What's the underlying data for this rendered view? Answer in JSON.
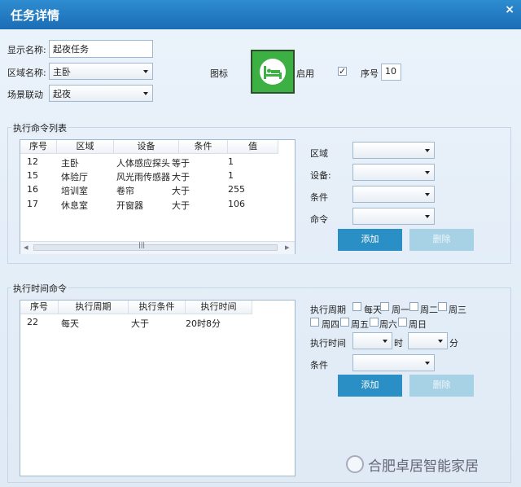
{
  "window": {
    "title": "任务详情",
    "close_glyph": "×"
  },
  "form": {
    "display_name_label": "显示名称:",
    "display_name_value": "起夜任务",
    "area_label": "区域名称:",
    "area_value": "主卧",
    "scene_label": "场景联动",
    "scene_value": "起夜",
    "icon_label": "图标",
    "enable_label": "启用",
    "enable_checked": "✓",
    "seq_label": "序号",
    "seq_value": "10"
  },
  "command_section": {
    "title": "执行命令列表",
    "columns": [
      "序号",
      "区域",
      "设备",
      "条件",
      "值"
    ],
    "rows": [
      [
        "12",
        "主卧",
        "人体感应探头",
        "等于",
        "1"
      ],
      [
        "15",
        "体验厅",
        "风光雨传感器",
        "大于",
        "1"
      ],
      [
        "16",
        "培训室",
        "卷帘",
        "大于",
        "255"
      ],
      [
        "17",
        "休息室",
        "开窗器",
        "大于",
        "106"
      ]
    ],
    "scroll_left": "◂",
    "scroll_right": "▸",
    "scroll_grip": "|||",
    "fields": {
      "area": "区域",
      "device": "设备:",
      "condition": "条件",
      "command": "命令"
    },
    "add_label": "添加",
    "delete_label": "删除"
  },
  "time_section": {
    "title": "执行时间命令",
    "columns": [
      "序号",
      "执行周期",
      "执行条件",
      "执行时间"
    ],
    "rows": [
      [
        "22",
        "每天",
        "大于",
        "20时8分"
      ]
    ],
    "period_label": "执行周期",
    "days": [
      "每天",
      "周一",
      "周二",
      "周三",
      "周四",
      "周五",
      "周六",
      "周日"
    ],
    "time_label": "执行时间",
    "hour_unit": "时",
    "minute_unit": "分",
    "condition_label": "条件",
    "add_label": "添加",
    "delete_label": "删除"
  },
  "watermark": {
    "text": "合肥卓居智能家居"
  },
  "colors": {
    "titlebar": "#1b6db6",
    "icon_bg": "#3cb043",
    "add_button": "#2a8fc4",
    "delete_button": "#a7d2e6"
  }
}
